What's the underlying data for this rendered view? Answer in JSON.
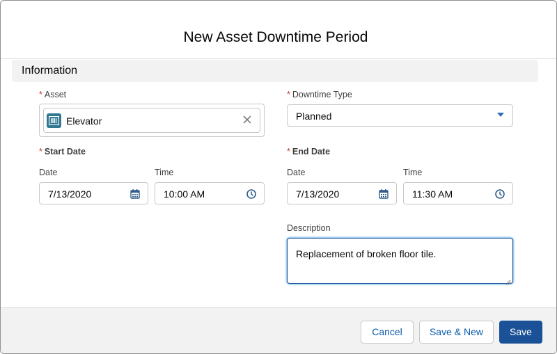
{
  "modal": {
    "title": "New Asset Downtime Period"
  },
  "section": {
    "title": "Information"
  },
  "asset": {
    "required_marker": "*",
    "label": "Asset",
    "value": "Elevator",
    "icon": "asset-icon",
    "icon_color": "#317992"
  },
  "downtime_type": {
    "required_marker": "*",
    "label": "Downtime Type",
    "value": "Planned"
  },
  "start": {
    "required_marker": "*",
    "label": "Start Date",
    "date_label": "Date",
    "date_value": "7/13/2020",
    "time_label": "Time",
    "time_value": "10:00 AM"
  },
  "end": {
    "required_marker": "*",
    "label": "End Date",
    "date_label": "Date",
    "date_value": "7/13/2020",
    "time_label": "Time",
    "time_value": "11:30 AM"
  },
  "description": {
    "label": "Description",
    "value": "Replacement of broken floor tile."
  },
  "footer": {
    "cancel_label": "Cancel",
    "save_new_label": "Save & New",
    "save_label": "Save"
  },
  "colors": {
    "brand": "#1b5297",
    "required": "#c23934",
    "link": "#0b5cab"
  }
}
